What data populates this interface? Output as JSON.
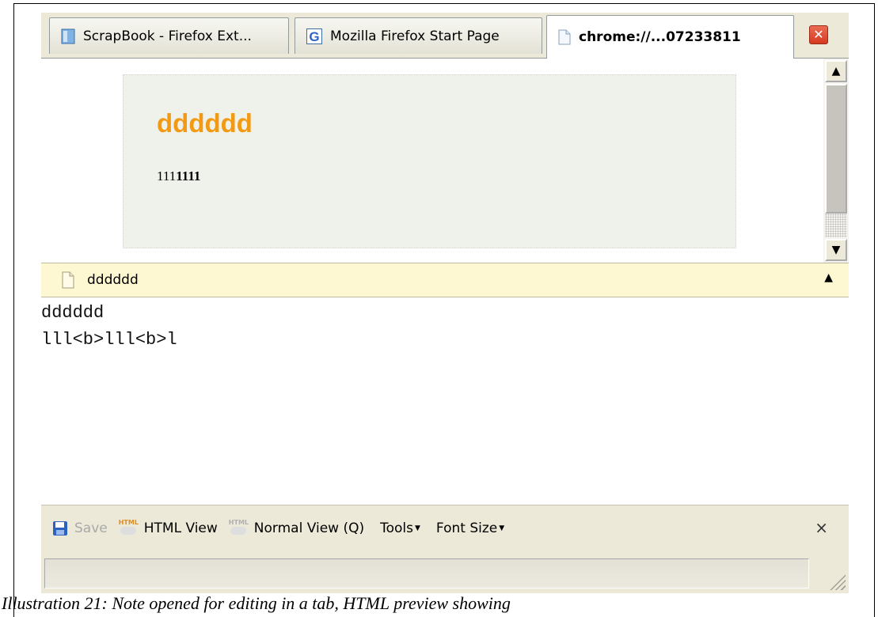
{
  "tabs": [
    {
      "label": "ScrapBook - Firefox Ext...",
      "icon": "scrapbook-icon"
    },
    {
      "label": "Mozilla Firefox Start Page",
      "icon": "google-icon"
    },
    {
      "label": "chrome://...07233811",
      "icon": "page-icon",
      "active": true
    }
  ],
  "preview": {
    "title": "dddddd",
    "body_a": "111",
    "body_b": "1111"
  },
  "note_header": {
    "title": "dddddd",
    "collapse_glyph": "▲"
  },
  "editor": {
    "content": "dddddd\nlll<b>lll<b>l"
  },
  "toolbar": {
    "save": "Save",
    "html_view": "HTML View",
    "normal_view": "Normal View (Q)",
    "tools": "Tools",
    "font_size": "Font Size",
    "close_glyph": "×"
  },
  "caption": "Illustration 21: Note opened for editing in a tab, HTML preview showing",
  "colors": {
    "note_title": "#f39a14",
    "note_bg": "#eef2ea",
    "header_bg": "#fdf8d2",
    "chrome": "#ece9d8"
  }
}
